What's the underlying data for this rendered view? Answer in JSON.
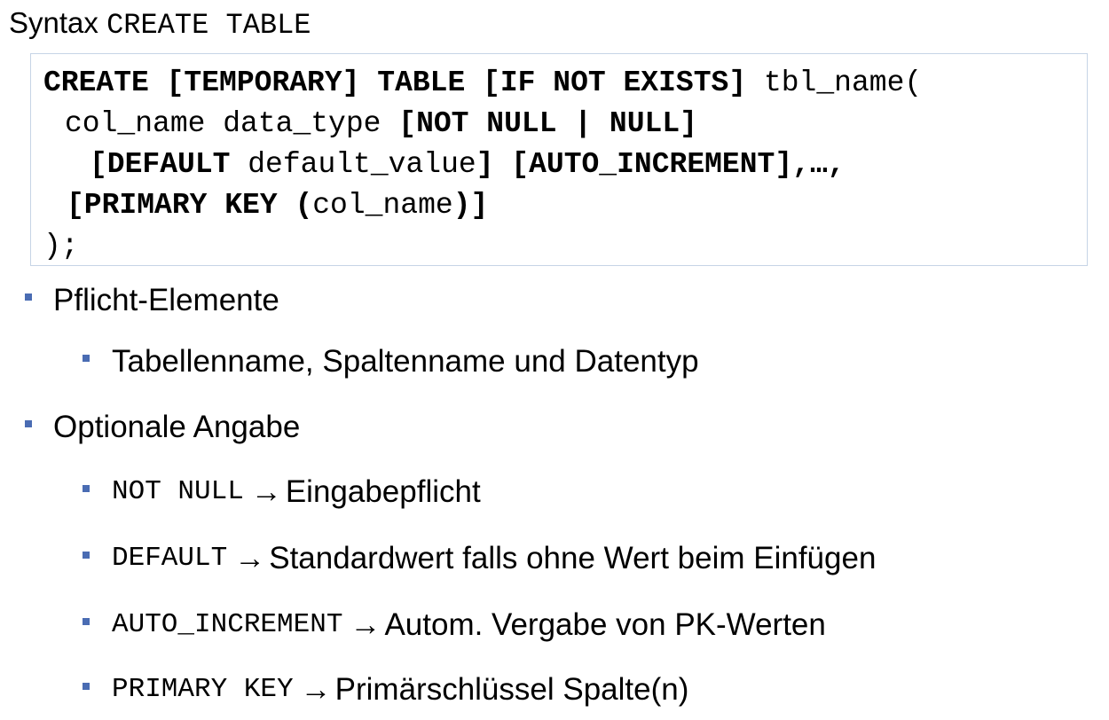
{
  "title": {
    "label": "Syntax",
    "code": "CREATE TABLE"
  },
  "code": {
    "line1": {
      "keywords": "CREATE [TEMPORARY] TABLE [IF NOT EXISTS]",
      "plain": " tbl_name("
    },
    "line2": {
      "plain": "col_name data_type ",
      "keywords": "[NOT NULL | NULL]"
    },
    "line3": {
      "kw1": "[DEFAULT",
      "plain": " default_value",
      "kw2": "] [AUTO_INCREMENT],…,"
    },
    "line4": {
      "kw1": "[PRIMARY KEY (",
      "plain": "col_name",
      "kw2": ")]"
    },
    "line5": {
      "plain": ");"
    }
  },
  "bullets": {
    "mandatory": {
      "label": "Pflicht-Elemente",
      "items": [
        "Tabellenname, Spaltenname und Datentyp"
      ]
    },
    "optional": {
      "label": "Optionale Angabe",
      "items": [
        {
          "code": "NOT NULL",
          "arrow": "→",
          "text": "Eingabepflicht"
        },
        {
          "code": "DEFAULT",
          "arrow": "→",
          "text": "Standardwert falls ohne Wert beim Einfügen"
        },
        {
          "code": "AUTO_INCREMENT",
          "arrow": "→",
          "text": "Autom. Vergabe von PK-Werten"
        },
        {
          "code": "PRIMARY KEY",
          "arrow": "→",
          "text": "Primärschlüssel Spalte(n)"
        }
      ]
    }
  },
  "colors": {
    "bullet": "#4a6cb3",
    "box_border": "#c6d4e6"
  }
}
